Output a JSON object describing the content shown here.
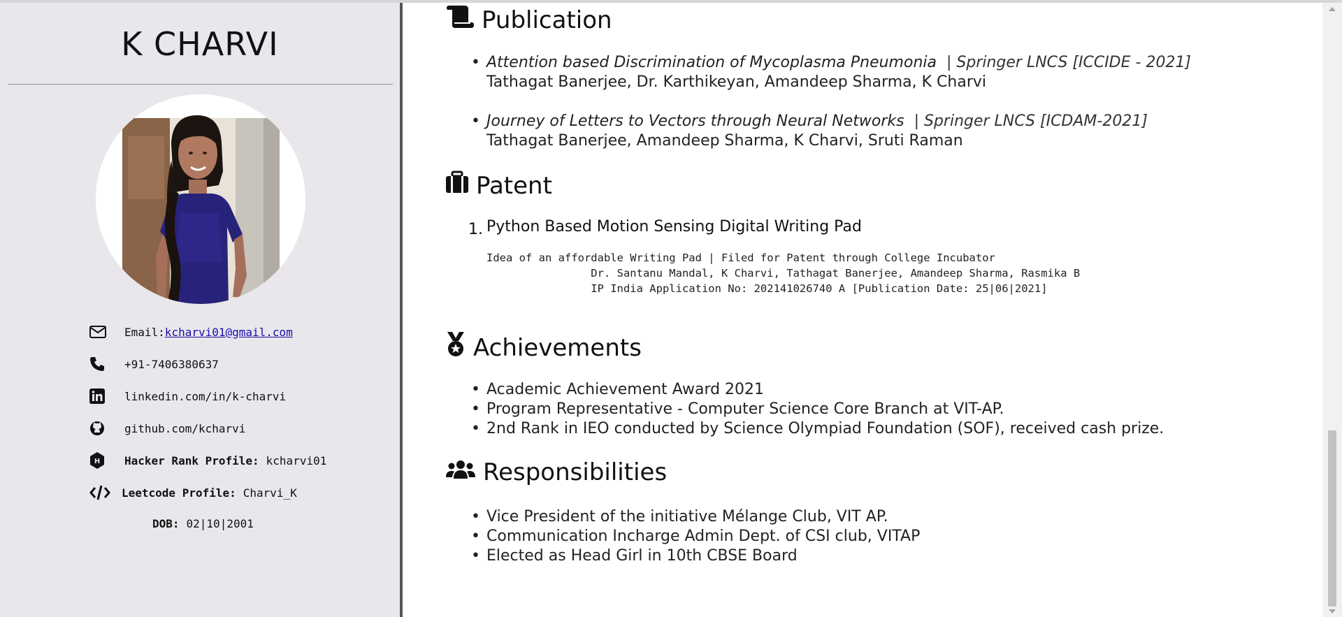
{
  "sidebar": {
    "name": "K CHARVI",
    "contacts": {
      "email_label": "Email:",
      "email_value": "kcharvi01@gmail.com",
      "phone": "+91-7406380637",
      "linkedin": "linkedin.com/in/k-charvi",
      "github": "github.com/kcharvi",
      "hackerrank_label": "Hacker Rank Profile:",
      "hackerrank_value": "kcharvi01",
      "leetcode_label": "Leetcode Profile:",
      "leetcode_value": "Charvi_K",
      "dob_label": "DOB:",
      "dob_value": "02|10|2001"
    }
  },
  "publication": {
    "title": "Publication",
    "items": [
      {
        "title": "Attention based Discrimination of Mycoplasma Pneumonia",
        "venue": "| Springer LNCS [ICCIDE - 2021]",
        "authors": "Tathagat Banerjee, Dr. Karthikeyan, Amandeep Sharma, K Charvi"
      },
      {
        "title": "Journey of Letters to Vectors through Neural Networks",
        "venue": "| Springer LNCS [ICDAM-2021]",
        "authors": "Tathagat Banerjee, Amandeep Sharma, K Charvi, Sruti Raman"
      }
    ]
  },
  "patent": {
    "title": "Patent",
    "number": "1.",
    "item_title": "Python Based Motion Sensing Digital Writing Pad",
    "line1": "Idea of an affordable Writing Pad | Filed for Patent through College Incubator",
    "line2": "                Dr. Santanu Mandal, K Charvi, Tathagat Banerjee, Amandeep Sharma, Rasmika B",
    "line3": "                IP India Application No: 202141026740 A [Publication Date: 25|06|2021]"
  },
  "achievements": {
    "title": "Achievements",
    "items": [
      "Academic Achievement Award 2021",
      "Program Representative - Computer Science Core Branch at VIT-AP.",
      "2nd Rank in IEO conducted by Science Olympiad Foundation (SOF), received cash prize."
    ]
  },
  "responsibilities": {
    "title": "Responsibilities",
    "items": [
      "Vice President of the initiative Mélange Club, VIT AP.",
      "Communication Incharge Admin Dept. of CSI club, VITAP",
      "Elected as Head Girl in 10th CBSE Board"
    ]
  },
  "icons": {
    "email": "envelope-icon",
    "phone": "phone-icon",
    "linkedin": "linkedin-icon",
    "github": "github-icon",
    "hackerrank": "hackerrank-icon",
    "leetcode": "code-icon",
    "publication": "scroll-icon",
    "patent": "suitcase-icon",
    "achievements": "medal-icon",
    "responsibilities": "users-icon"
  }
}
